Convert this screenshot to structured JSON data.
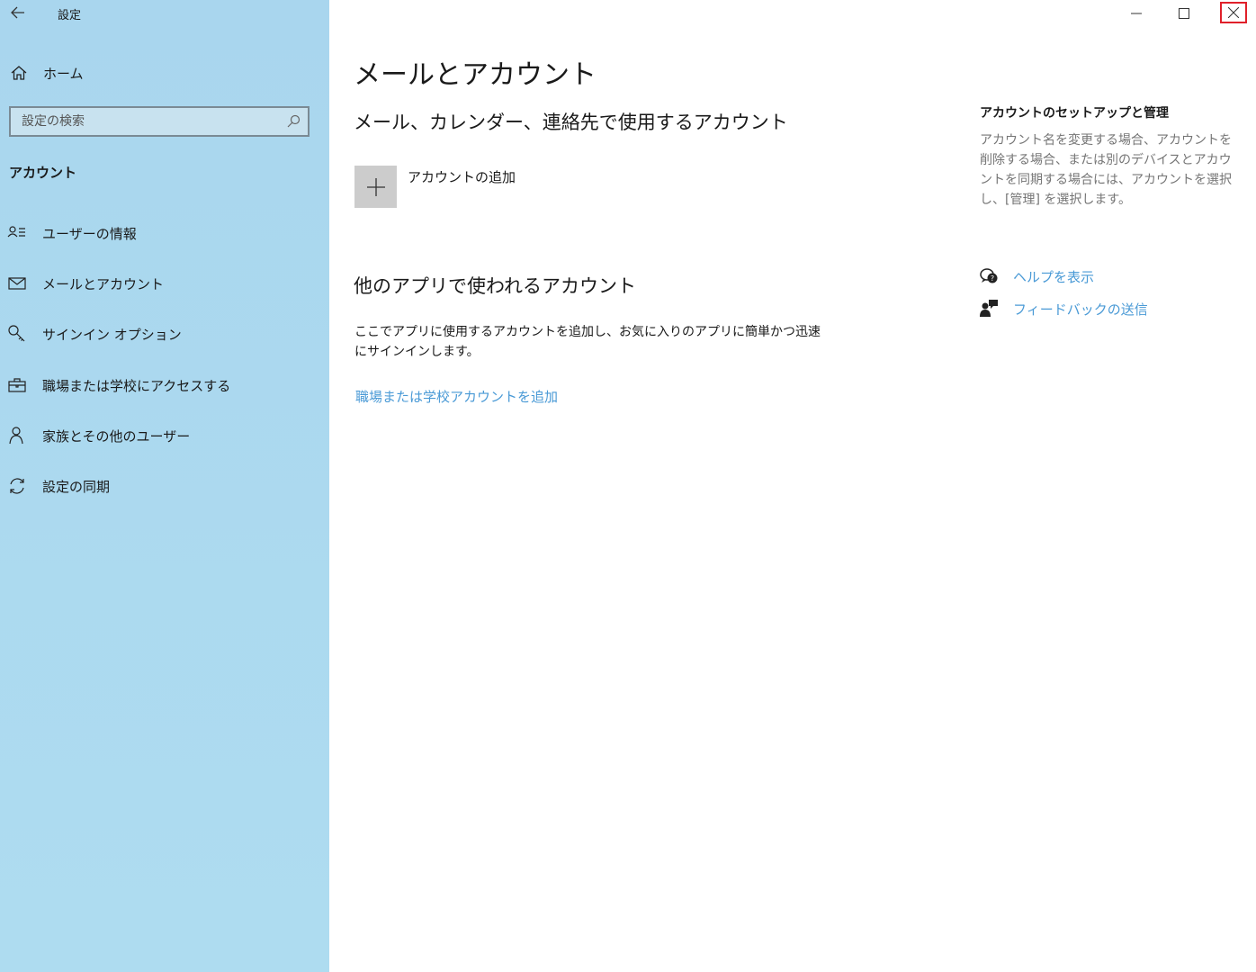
{
  "window": {
    "title": "設定",
    "controls": [
      "minimize",
      "maximize",
      "close"
    ]
  },
  "sidebar": {
    "home_label": "ホーム",
    "search_placeholder": "設定の検索",
    "section_title": "アカウント",
    "items": [
      {
        "label": "ユーザーの情報",
        "icon": "user-info-icon"
      },
      {
        "label": "メールとアカウント",
        "icon": "mail-icon"
      },
      {
        "label": "サインイン オプション",
        "icon": "key-icon"
      },
      {
        "label": "職場または学校にアクセスする",
        "icon": "briefcase-icon"
      },
      {
        "label": "家族とその他のユーザー",
        "icon": "person-icon"
      },
      {
        "label": "設定の同期",
        "icon": "sync-icon"
      }
    ]
  },
  "main": {
    "title": "メールとアカウント",
    "section1_title": "メール、カレンダー、連絡先で使用するアカウント",
    "add_account_label": "アカウントの追加",
    "section2_title": "他のアプリで使われるアカウント",
    "section2_desc": "ここでアプリに使用するアカウントを追加し、お気に入りのアプリに簡単かつ迅速にサインインします。",
    "work_account_link": "職場または学校アカウントを追加"
  },
  "related": {
    "title": "アカウントのセットアップと管理",
    "desc": "アカウント名を変更する場合、アカウントを削除する場合、または別のデバイスとアカウントを同期する場合には、アカウントを選択し、[管理] を選択します。",
    "help_link": "ヘルプを表示",
    "feedback_link": "フィードバックの送信"
  },
  "colors": {
    "sidebar_bg": "#aedaf0",
    "link": "#4a9ad6",
    "highlight": "#e0202a"
  }
}
